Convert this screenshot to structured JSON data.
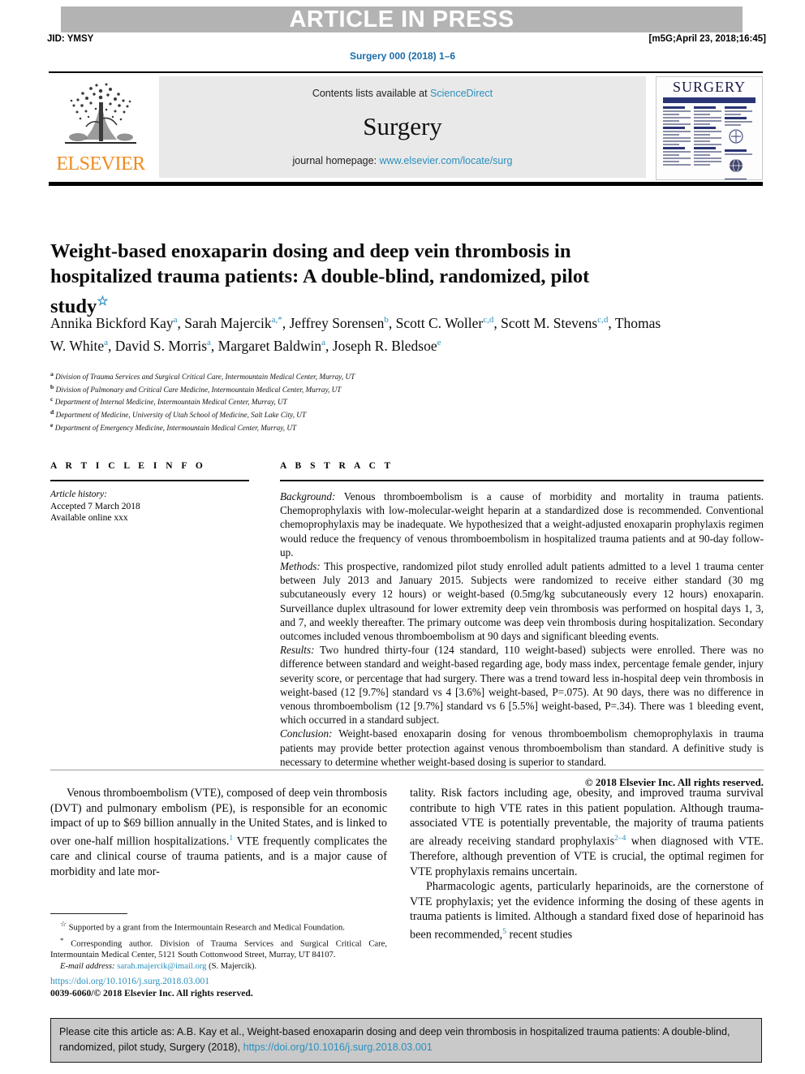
{
  "banner": {
    "article_in_press": "ARTICLE IN PRESS",
    "jid": "JID: YMSY",
    "stamp": "[m5G;April 23, 2018;16:45]",
    "running_head": "Surgery 000 (2018) 1–6"
  },
  "masthead": {
    "publisher_logo_text": "ELSEVIER",
    "contents_prefix": "Contents lists available at ",
    "contents_link": "ScienceDirect",
    "journal_name": "Surgery",
    "homepage_prefix": "journal homepage: ",
    "homepage_link": "www.elsevier.com/locate/surg",
    "cover_title": "SURGERY"
  },
  "article": {
    "title": "Weight-based enoxaparin dosing and deep vein thrombosis in hospitalized trauma patients: A double-blind, randomized, pilot study",
    "title_footnote_marker": "☆",
    "authors_html": "Annika Bickford Kay<sup>a</sup>, Sarah Majercik<sup>a,*</sup>, Jeffrey Sorensen<sup>b</sup>, Scott C. Woller<sup>c,d</sup>, Scott M. Stevens<sup>c,d</sup>, Thomas W. White<sup>a</sup>, David S. Morris<sup>a</sup>, Margaret Baldwin<sup>a</sup>, Joseph R. Bledsoe<sup>e</sup>",
    "affiliations": [
      {
        "marker": "a",
        "text": "Division of Trauma Services and Surgical Critical Care, Intermountain Medical Center, Murray, UT"
      },
      {
        "marker": "b",
        "text": "Division of Pulmonary and Critical Care Medicine, Intermountain Medical Center, Murray, UT"
      },
      {
        "marker": "c",
        "text": "Department of Internal Medicine, Intermountain Medical Center, Murray, UT"
      },
      {
        "marker": "d",
        "text": "Department of Medicine, University of Utah School of Medicine, Salt Lake City, UT"
      },
      {
        "marker": "e",
        "text": "Department of Emergency Medicine, Intermountain Medical Center, Murray, UT"
      }
    ]
  },
  "article_info": {
    "heading": "A R T I C L E  I N F O",
    "history_label": "Article history:",
    "accepted": "Accepted 7 March 2018",
    "available": "Available online xxx"
  },
  "abstract": {
    "heading": "A B S T R A C T",
    "sections": [
      {
        "label": "Background:",
        "text": " Venous thromboembolism is a cause of morbidity and mortality in trauma patients. Chemoprophylaxis with low-molecular-weight heparin at a standardized dose is recommended. Conventional chemoprophylaxis may be inadequate. We hypothesized that a weight-adjusted enoxaparin prophylaxis regimen would reduce the frequency of venous thromboembolism in hospitalized trauma patients and at 90-day follow-up."
      },
      {
        "label": "Methods:",
        "text": " This prospective, randomized pilot study enrolled adult patients admitted to a level 1 trauma center between July 2013 and January 2015. Subjects were randomized to receive either standard (30 mg subcutaneously every 12 hours) or weight-based (0.5mg/kg subcutaneously every 12 hours) enoxaparin. Surveillance duplex ultrasound for lower extremity deep vein thrombosis was performed on hospital days 1, 3, and 7, and weekly thereafter. The primary outcome was deep vein thrombosis during hospitalization. Secondary outcomes included venous thromboembolism at 90 days and significant bleeding events."
      },
      {
        "label": "Results:",
        "text": " Two hundred thirty-four (124 standard, 110 weight-based) subjects were enrolled. There was no difference between standard and weight-based regarding age, body mass index, percentage female gender, injury severity score, or percentage that had surgery. There was a trend toward less in-hospital deep vein thrombosis in weight-based (12 [9.7%] standard vs 4 [3.6%] weight-based, P=.075). At 90 days, there was no difference in venous thromboembolism (12 [9.7%] standard vs 6 [5.5%] weight-based, P=.34). There was 1 bleeding event, which occurred in a standard subject."
      },
      {
        "label": "Conclusion:",
        "text": " Weight-based enoxaparin dosing for venous thromboembolism chemoprophylaxis in trauma patients may provide better protection against venous thromboembolism than standard. A definitive study is necessary to determine whether weight-based dosing is superior to standard."
      }
    ],
    "copyright": "© 2018 Elsevier Inc. All rights reserved."
  },
  "body": {
    "left_paragraph_1": "Venous thromboembolism (VTE), composed of deep vein thrombosis (DVT) and pulmonary embolism (PE), is responsible for an economic impact of up to $69 billion annually in the United States, and is linked to over one-half million hospitalizations.",
    "left_paragraph_1_ref": "1",
    "left_paragraph_1_cont": " VTE frequently complicates the care and clinical course of trauma patients, and is a major cause of morbidity and late mor-",
    "right_paragraph_1": "tality. Risk factors including age, obesity, and improved trauma survival contribute to high VTE rates in this patient population. Although trauma-associated VTE is potentially preventable, the majority of trauma patients are already receiving standard prophylaxis",
    "right_paragraph_1_ref": "2–4",
    "right_paragraph_1_cont": " when diagnosed with VTE. Therefore, although prevention of VTE is crucial, the optimal regimen for VTE prophylaxis remains uncertain.",
    "right_paragraph_2": "Pharmacologic agents, particularly heparinoids, are the cornerstone of VTE prophylaxis; yet the evidence informing the dosing of these agents in trauma patients is limited. Although a standard fixed dose of heparinoid has been recommended,",
    "right_paragraph_2_ref": "5",
    "right_paragraph_2_cont": " recent studies"
  },
  "footnotes": {
    "funding_marker": "☆",
    "funding": "Supported by a grant from the Intermountain Research and Medical Foundation.",
    "corresponding_marker": "*",
    "corresponding": "Corresponding author. Division of Trauma Services and Surgical Critical Care, Intermountain Medical Center, 5121 South Cottonwood Street, Murray, UT 84107.",
    "email_label": "E-mail address:",
    "email": "sarah.majercik@imail.org",
    "email_owner": "(S. Majercik)."
  },
  "imprint": {
    "doi_url": "https://doi.org/10.1016/j.surg.2018.03.001",
    "issn_line": "0039-6060/© 2018 Elsevier Inc. All rights reserved."
  },
  "citation_box": {
    "text_before_link": "Please cite this article as: A.B. Kay et al., Weight-based enoxaparin dosing and deep vein thrombosis in hospitalized trauma patients: A double-blind, randomized, pilot study, Surgery (2018), ",
    "link": "https://doi.org/10.1016/j.surg.2018.03.001"
  },
  "colors": {
    "link": "#2a8fbd",
    "banner_grey": "#b3b3b3",
    "panel_grey": "#e9e9e9",
    "elsevier_orange": "#f08a1e"
  }
}
